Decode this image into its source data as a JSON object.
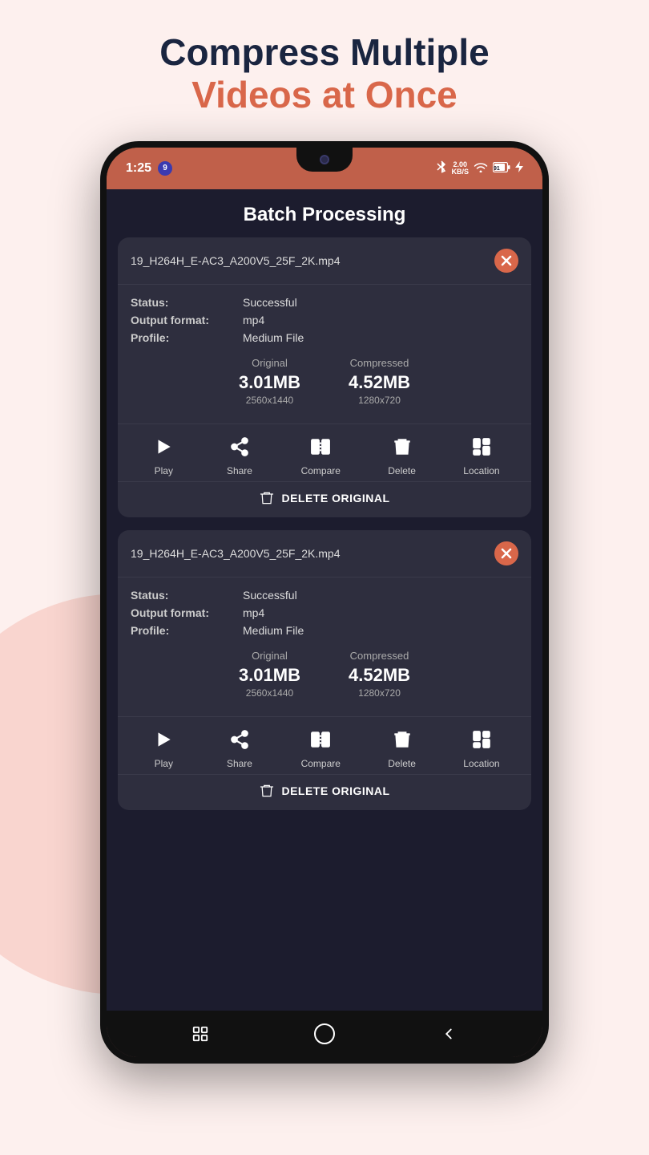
{
  "page": {
    "headline_line1": "Compress Multiple",
    "headline_line2": "Videos at Once"
  },
  "app": {
    "title": "Batch Processing",
    "status_bar": {
      "time": "1:25",
      "notif_count": "9",
      "battery": "91%"
    },
    "cards": [
      {
        "id": "card-1",
        "filename": "19_H264H_E-AC3_A200V5_25F_2K.mp4",
        "status_label": "Status:",
        "status_value": "Successful",
        "format_label": "Output format:",
        "format_value": "mp4",
        "profile_label": "Profile:",
        "profile_value": "Medium File",
        "original_label": "Original",
        "original_size": "3.01MB",
        "original_dim": "2560x1440",
        "compressed_label": "Compressed",
        "compressed_size": "4.52MB",
        "compressed_dim": "1280x720",
        "actions": [
          {
            "id": "play",
            "label": "Play"
          },
          {
            "id": "share",
            "label": "Share"
          },
          {
            "id": "compare",
            "label": "Compare"
          },
          {
            "id": "delete",
            "label": "Delete"
          },
          {
            "id": "location",
            "label": "Location"
          }
        ],
        "delete_original": "DELETE ORIGINAL"
      },
      {
        "id": "card-2",
        "filename": "19_H264H_E-AC3_A200V5_25F_2K.mp4",
        "status_label": "Status:",
        "status_value": "Successful",
        "format_label": "Output format:",
        "format_value": "mp4",
        "profile_label": "Profile:",
        "profile_value": "Medium File",
        "original_label": "Original",
        "original_size": "3.01MB",
        "original_dim": "2560x1440",
        "compressed_label": "Compressed",
        "compressed_size": "4.52MB",
        "compressed_dim": "1280x720",
        "actions": [
          {
            "id": "play",
            "label": "Play"
          },
          {
            "id": "share",
            "label": "Share"
          },
          {
            "id": "compare",
            "label": "Compare"
          },
          {
            "id": "delete",
            "label": "Delete"
          },
          {
            "id": "location",
            "label": "Location"
          }
        ],
        "delete_original": "DELETE ORIGINAL"
      }
    ]
  }
}
